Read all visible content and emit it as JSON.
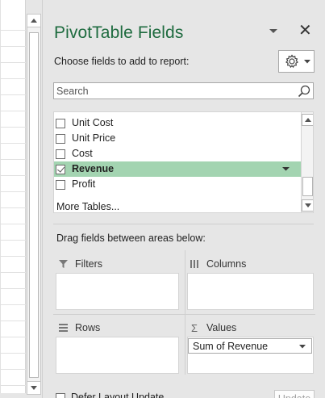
{
  "pane": {
    "title": "PivotTable Fields",
    "choose_label": "Choose fields to add to report:",
    "search_placeholder": "Search",
    "accent_color": "#1e6b3f",
    "selected_row_color": "#a3d4b1"
  },
  "fields": [
    {
      "label": "Unit Cost",
      "checked": false
    },
    {
      "label": "Unit Price",
      "checked": false
    },
    {
      "label": "Cost",
      "checked": false
    },
    {
      "label": "Revenue",
      "checked": true
    },
    {
      "label": "Profit",
      "checked": false
    }
  ],
  "more_tables": "More Tables...",
  "drag_label": "Drag fields between areas below:",
  "areas": {
    "filters": "Filters",
    "columns": "Columns",
    "rows": "Rows",
    "values": "Values",
    "values_item": "Sum of Revenue"
  },
  "footer": {
    "defer_label": "Defer Layout Update",
    "update_label": "Update"
  },
  "icons": [
    "chevron-down-icon",
    "close-icon",
    "gear-icon",
    "search-icon",
    "filter-icon",
    "columns-icon",
    "rows-icon",
    "sigma-icon"
  ]
}
